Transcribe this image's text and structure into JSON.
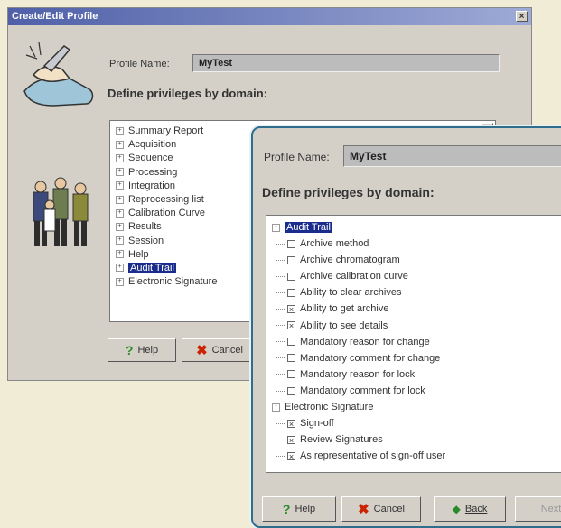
{
  "back_dialog": {
    "title": "Create/Edit Profile",
    "close_glyph": "×",
    "profile_label": "Profile Name:",
    "profile_value": "MyTest",
    "heading": "Define privileges by domain:",
    "scroll_glyph": "▲",
    "domains": [
      {
        "label": "Summary Report",
        "expander": "+",
        "selected": false
      },
      {
        "label": "Acquisition",
        "expander": "+",
        "selected": false
      },
      {
        "label": "Sequence",
        "expander": "+",
        "selected": false
      },
      {
        "label": "Processing",
        "expander": "+",
        "selected": false
      },
      {
        "label": "Integration",
        "expander": "+",
        "selected": false
      },
      {
        "label": "Reprocessing list",
        "expander": "+",
        "selected": false
      },
      {
        "label": "Calibration Curve",
        "expander": "+",
        "selected": false
      },
      {
        "label": "Results",
        "expander": "+",
        "selected": false
      },
      {
        "label": "Session",
        "expander": "+",
        "selected": false
      },
      {
        "label": "Help",
        "expander": "+",
        "selected": false
      },
      {
        "label": "Audit Trail",
        "expander": "+",
        "selected": true
      },
      {
        "label": "Electronic Signature",
        "expander": "+",
        "selected": false
      }
    ],
    "help_label": "Help",
    "cancel_label": "Cancel"
  },
  "front_dialog": {
    "profile_label": "Profile Name:",
    "profile_value": "MyTest",
    "heading": "Define privileges by domain:",
    "tree": [
      {
        "label": "Audit Trail",
        "expander": "-",
        "selected": true,
        "children": [
          {
            "label": "Archive method",
            "checked": false
          },
          {
            "label": "Archive chromatogram",
            "checked": false
          },
          {
            "label": "Archive calibration curve",
            "checked": false
          },
          {
            "label": "Ability to clear archives",
            "checked": false
          },
          {
            "label": "Ability to get archive",
            "checked": true
          },
          {
            "label": "Ability to see details",
            "checked": true
          },
          {
            "label": "Mandatory reason for change",
            "checked": false
          },
          {
            "label": "Mandatory comment for change",
            "checked": false
          },
          {
            "label": "Mandatory reason for lock",
            "checked": false
          },
          {
            "label": "Mandatory comment for lock",
            "checked": false
          }
        ]
      },
      {
        "label": "Electronic Signature",
        "expander": "-",
        "selected": false,
        "children": [
          {
            "label": "Sign-off",
            "checked": true
          },
          {
            "label": "Review Signatures",
            "checked": true
          },
          {
            "label": "As representative of sign-off user",
            "checked": true
          }
        ]
      }
    ],
    "help_label": "Help",
    "cancel_label": "Cancel",
    "back_label": "Back",
    "next_label": "Next",
    "check_glyph": "×"
  },
  "icons": {
    "help": "?",
    "cancel": "✖",
    "back": "◆"
  },
  "colors": {
    "title_bar": "#4f60a8",
    "selection": "#1a2c8c",
    "front_border": "#2f6d8c",
    "background": "#f1ecd6"
  }
}
